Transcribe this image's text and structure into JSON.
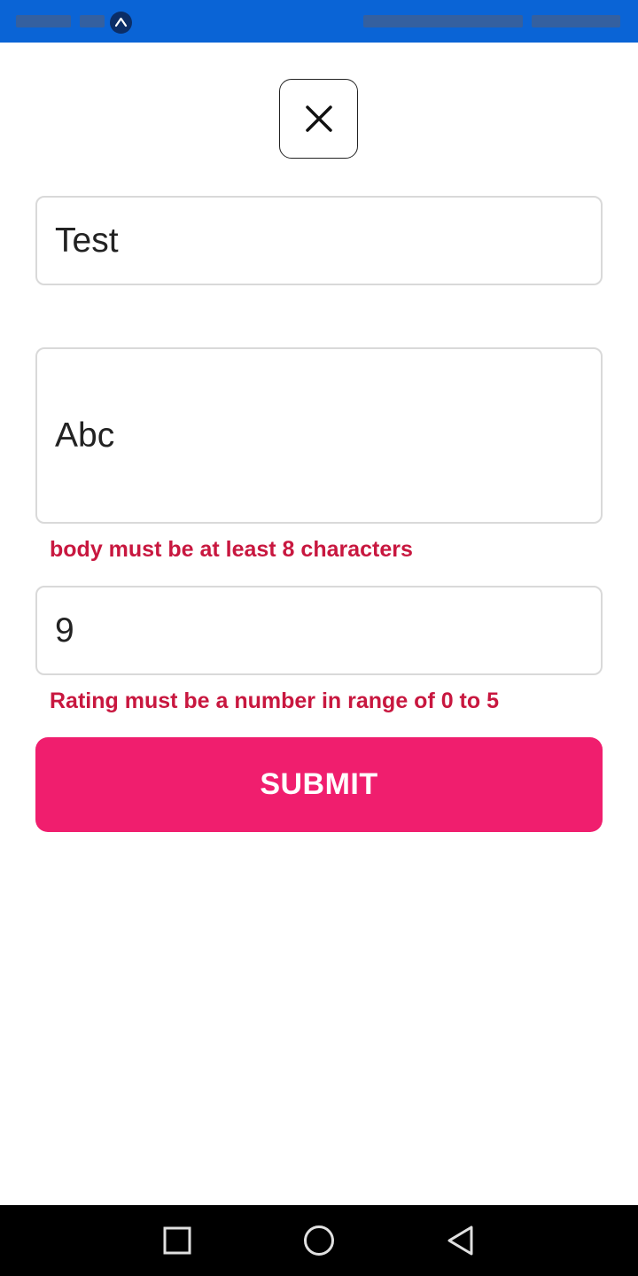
{
  "status_bar": {
    "color": "#0a64d6",
    "app_icon": "expo-icon"
  },
  "close_button": {
    "icon": "close-icon"
  },
  "form": {
    "title_value": "Test",
    "body_value": "Abc",
    "body_error": "body must be at least 8 characters",
    "rating_value": "9",
    "rating_error": "Rating must be a number in range of 0 to 5",
    "submit_label": "SUBMIT"
  },
  "colors": {
    "accent": "#f01e6e",
    "error": "#c8173f"
  },
  "nav_bar": {
    "icons": [
      "recents-icon",
      "home-icon",
      "back-icon"
    ]
  }
}
